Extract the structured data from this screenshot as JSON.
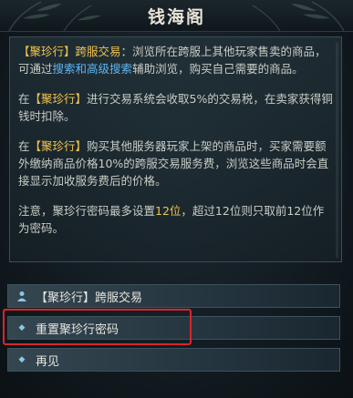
{
  "window": {
    "title": "钱海阁"
  },
  "content": {
    "p1": {
      "bracket_term": "【聚珍行】",
      "term_suffix": "跨服交易",
      "t1": "：浏览所在跨服上其他玩家售卖的商品，可通过",
      "link1": "搜索",
      "t2": "和",
      "link2": "高级搜索",
      "t3": "辅助浏览，购买自己需要的商品。"
    },
    "p2": {
      "t1": "在",
      "bracket_term": "【聚珍行】",
      "t2": "进行交易系统会收取5%的交易税，在卖家获得铜钱时扣除。"
    },
    "p3": {
      "t1": "在",
      "bracket_term": "【聚珍行】",
      "t2": "购买其他服务器玩家上架的商品时，买家需要额外缴纳商品价格10%的跨服交易服务费，浏览这些商品时会直接显示加收服务费后的价格。"
    },
    "p4": {
      "t1": "注意，聚珍行密码最多设置",
      "num": "12位",
      "t2": "，超过12位则只取前12位作为密码。"
    }
  },
  "options": [
    {
      "icon": "person-icon",
      "label": "【聚珍行】跨服交易"
    },
    {
      "icon": "diamond-icon",
      "label": "重置聚珍行密码"
    },
    {
      "icon": "diamond-icon",
      "label": "再见"
    }
  ],
  "colors": {
    "gold": "#f0c24e",
    "blue": "#5fb6f2",
    "highlight": "#d8262a"
  }
}
